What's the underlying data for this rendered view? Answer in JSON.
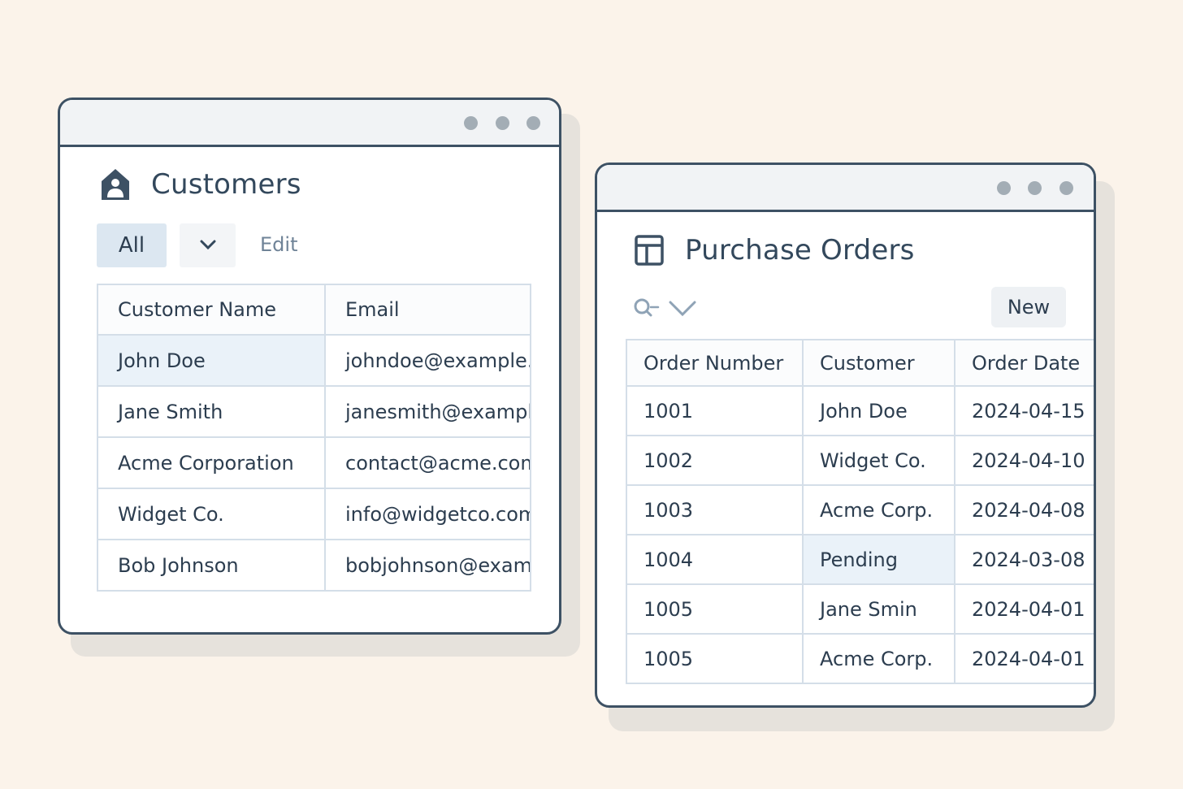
{
  "customers_window": {
    "title": "Customers",
    "filter_label": "All",
    "edit_label": "Edit",
    "table": {
      "headers": [
        "Customer Name",
        "Email"
      ],
      "rows": [
        [
          "John Doe",
          "johndoe@example.c"
        ],
        [
          "Jane Smith",
          "janesmith@example"
        ],
        [
          "Acme Corporation",
          "contact@acme.com"
        ],
        [
          "Widget Co.",
          "info@widgetco.com"
        ],
        [
          "Bob Johnson",
          "bobjohnson@examp"
        ]
      ]
    }
  },
  "orders_window": {
    "title": "Purchase Orders",
    "new_label": "New",
    "table": {
      "headers": [
        "Order Number",
        "Customer",
        "Order Date"
      ],
      "rows": [
        [
          "1001",
          "John Doe",
          "2024-04-15"
        ],
        [
          "1002",
          "Widget Co.",
          "2024-04-10"
        ],
        [
          "1003",
          "Acme Corp.",
          "2024-04-08"
        ],
        [
          "1004",
          "Pending",
          "2024-03-08"
        ],
        [
          "1005",
          "Jane Smin",
          "2024-04-01"
        ],
        [
          "1005",
          "Acme Corp.",
          "2024-04-01"
        ]
      ]
    }
  },
  "colors": {
    "background": "#fbf3ea",
    "window_border": "#3d5164",
    "selected_fill": "#eaf2f9",
    "filter_button": "#dce7f1"
  },
  "icons": {
    "customers": "home-user-icon",
    "orders": "layout-table-icon",
    "search": "search-icon",
    "dropdown": "chevron-down-icon"
  }
}
